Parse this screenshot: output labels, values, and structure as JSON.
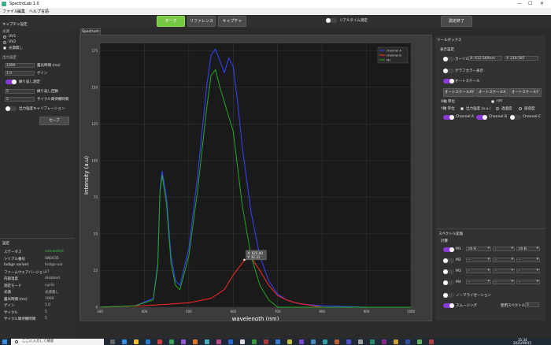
{
  "app": {
    "title": "SpectroLab 1.0",
    "min": "—",
    "max": "☐",
    "close": "✕"
  },
  "menu": [
    "ファイル",
    "編集",
    "ヘルプ",
    "言語"
  ],
  "toolbar": {
    "buttons": [
      "ダーク",
      "リファレンス",
      "キャプチャ"
    ],
    "realtime_label": "リアルタイム測定",
    "end_button": "測定終了"
  },
  "left": {
    "capture_settings": "キャプチャ設定",
    "light_source": "光源",
    "sources": [
      "UV1",
      "UV2",
      "光源無し"
    ],
    "output_settings": "出力設定",
    "exposure_value": "1000",
    "exposure_label": "露光時間 (ms)",
    "gain_value": "1.0",
    "gain_label": "ゲイン",
    "repeat_label": "繰り返し測定",
    "repeat_count_value": "5",
    "repeat_count_label": "繰り返し回数",
    "cycle_value": "5",
    "cycle_label": "サイクル間待機時間",
    "calibration_label": "出力強度キャリブレーション",
    "save_button": "セーブ",
    "settings_heading": "設定",
    "info": [
      {
        "k": "ステータス",
        "v": "connected"
      },
      {
        "k": "シリアル番号",
        "v": "SN0035"
      },
      {
        "k": "Indigo variant",
        "v": "Indigo-var"
      },
      {
        "k": "ファームウェアバージョン",
        "v": "17"
      },
      {
        "k": "内部温度",
        "v": "disabled"
      },
      {
        "k": "測定モード",
        "v": "cyclic"
      },
      {
        "k": "光源",
        "v": "光源無し"
      },
      {
        "k": "露光時間 (ms)",
        "v": "1000"
      },
      {
        "k": "ゲイン",
        "v": "1.0"
      },
      {
        "k": "サイクル",
        "v": "5"
      },
      {
        "k": "サイクル間待機時間",
        "v": "5"
      }
    ]
  },
  "tab": "Spectrum",
  "right": {
    "toolbox": "ツールボックス",
    "display_settings": "表示設定",
    "cursor_label": "カーソル",
    "cursor_x": "X: 612.569nm",
    "cursor_y": "Y: 216.587",
    "graph_color": "グラフカラー表示",
    "autoscale": "オートスケール",
    "autoscale_buttons": [
      "オートスケールXY",
      "オートスケールX",
      "オートスケールY"
    ],
    "x_axis": "X軸 単位",
    "x_unit": "nm",
    "y_axis": "Y軸 単位",
    "y_units": [
      "出力強度 (a.u.)",
      "透過度",
      "吸収度"
    ],
    "channels": [
      "Channel A",
      "Channel B",
      "Channel C"
    ],
    "spectral": "スペクトル変換",
    "calc": "計算",
    "m_rows": [
      {
        "name": "M1",
        "a": "ch A",
        "op": "-",
        "b": "ch B"
      },
      {
        "name": "M2",
        "a": "-",
        "op": "-",
        "b": "-"
      },
      {
        "name": "M3",
        "a": "-",
        "op": "-",
        "b": "-"
      },
      {
        "name": "M4",
        "a": "-",
        "op": "-",
        "b": "-"
      }
    ],
    "normalization": "ノーマライゼーション",
    "smoothing": "スムージング",
    "smoothing_label": "使用スペクトル数",
    "smoothing_value": "5"
  },
  "taskbar": {
    "search": "ここに入力して検索",
    "time": "15:34",
    "date": "2021/09/15"
  },
  "chart_data": {
    "type": "line",
    "xlabel": "wavelength (nm)",
    "ylabel": "Intensity (a.u)",
    "xlim": [
      300,
      1000
    ],
    "ylim": [
      0,
      180
    ],
    "xticks": [
      300,
      400,
      500,
      600,
      700,
      800,
      900,
      1000
    ],
    "yticks": [
      0,
      25,
      50,
      75,
      100,
      125,
      150,
      175
    ],
    "legend": [
      "channel A",
      "channel B",
      "M1"
    ],
    "legend_position": "top-right",
    "grid": true,
    "series": [
      {
        "name": "channel A",
        "color": "#3344ff",
        "x": [
          300,
          380,
          420,
          430,
          435,
          440,
          450,
          460,
          470,
          480,
          500,
          520,
          540,
          550,
          560,
          570,
          580,
          590,
          600,
          610,
          620,
          640,
          660,
          680,
          700,
          720,
          740,
          760,
          800,
          900,
          1000
        ],
        "y": [
          0,
          1,
          6,
          30,
          80,
          93,
          75,
          35,
          18,
          15,
          40,
          90,
          150,
          172,
          176,
          168,
          160,
          170,
          164,
          140,
          110,
          65,
          35,
          18,
          9,
          5,
          3,
          2,
          1,
          0,
          0
        ]
      },
      {
        "name": "channel B",
        "color": "#ff2a2a",
        "x": [
          300,
          400,
          450,
          500,
          550,
          580,
          600,
          620,
          625,
          640,
          660,
          680,
          700,
          720,
          740,
          760,
          780,
          800,
          900,
          1000
        ],
        "y": [
          0,
          1,
          2,
          3,
          6,
          12,
          22,
          30,
          32,
          34,
          25,
          15,
          8,
          5,
          3,
          2,
          1,
          0,
          0,
          0
        ]
      },
      {
        "name": "M1",
        "color": "#22aa22",
        "x": [
          300,
          380,
          420,
          430,
          435,
          440,
          450,
          460,
          470,
          480,
          500,
          520,
          540,
          550,
          560,
          570,
          580,
          590,
          600,
          610,
          620,
          640,
          660,
          680,
          700,
          720,
          740,
          760,
          800,
          900,
          1000
        ],
        "y": [
          0,
          1,
          5,
          28,
          78,
          90,
          70,
          30,
          15,
          12,
          35,
          80,
          135,
          158,
          162,
          150,
          140,
          130,
          120,
          95,
          70,
          35,
          15,
          5,
          0,
          0,
          0,
          0,
          0,
          0,
          0
        ]
      }
    ],
    "tooltip": {
      "x": "X: 625.00",
      "y": "Y: 32.31"
    }
  }
}
